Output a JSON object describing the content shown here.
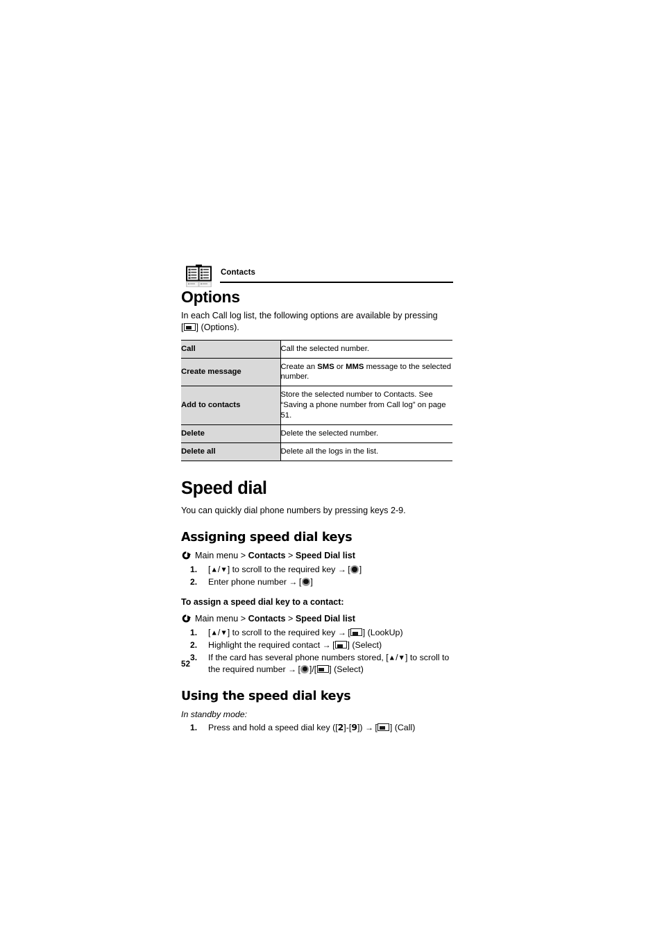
{
  "document": {
    "running_header": {
      "icon": "address-book-icon",
      "title": "Contacts"
    },
    "page_number": "52"
  },
  "sections": {
    "options": {
      "heading": "Options",
      "intro_before_key": "In each Call log list, the following options are available by pressing",
      "intro_key_icon": "softkey-icon",
      "intro_after_key": "] (Options).",
      "intro_bracket_open": "[",
      "table": {
        "rows": [
          {
            "name": "Call",
            "description": "Call the selected number."
          },
          {
            "name": "Create message",
            "desc_part1": "Create an ",
            "desc_bold1": "SMS",
            "desc_part2": " or ",
            "desc_bold2": "MMS",
            "desc_part3": " message to the selected number."
          },
          {
            "name": "Add to contacts",
            "description": "Store the selected number to Contacts. See “Saving a phone number from Call log” on page 51."
          },
          {
            "name": "Delete",
            "description": "Delete the selected number."
          },
          {
            "name": "Delete all",
            "description": "Delete all the logs in the list."
          }
        ]
      }
    },
    "speed_dial": {
      "heading": "Speed dial",
      "intro": "You can quickly dial phone numbers by pressing keys 2-9.",
      "assigning": {
        "heading": "Assigning speed dial keys",
        "path_prefix": "Main menu > ",
        "path_item1": "Contacts",
        "path_sep": " > ",
        "path_item2": "Speed Dial list",
        "steps": [
          {
            "open_bracket": "[",
            "up_arrow": "▲",
            "slash": "/",
            "down_arrow": "▼",
            "close_bracket": "]",
            "text": " to scroll to the required key ",
            "arrow": "→",
            "tail_open": " [",
            "tail_close": "]"
          },
          {
            "text": "Enter phone number ",
            "arrow": "→",
            "tail_open": " [",
            "tail_close": "]"
          }
        ]
      },
      "assign_to_contact": {
        "heading": "To assign a speed dial key to a contact:",
        "path_prefix": "Main menu > ",
        "path_item1": "Contacts",
        "path_sep": " > ",
        "path_item2": "Speed Dial list",
        "step1": {
          "open_bracket": "[",
          "up_arrow": "▲",
          "slash": "/",
          "down_arrow": "▼",
          "close_bracket": "]",
          "text": " to scroll to the required key ",
          "arrow": "→",
          "label": "] (LookUp)"
        },
        "step2": {
          "text": "Highlight the required contact ",
          "arrow": "→",
          "label": "] (Select)"
        },
        "step3": {
          "text_a": "If the card has several phone numbers stored, ",
          "open_bracket": "[",
          "up_arrow": "▲",
          "slash": "/",
          "down_arrow": "▼",
          "close_bracket": "]",
          "text_b": " to scroll to the required number ",
          "arrow": "→",
          "label": "] (Select)"
        }
      },
      "using": {
        "heading": "Using the speed dial keys",
        "mode_note": "In standby mode:",
        "step1": {
          "text_a": "Press and hold a speed dial key ([",
          "key_low": "2",
          "text_b": "]-[",
          "key_high": "9",
          "text_c": "]) ",
          "arrow": "→",
          "label": "] (Call)"
        }
      }
    }
  },
  "colors": {
    "table_header_cell_bg": "#d9d9d9",
    "rule": "#000000",
    "text": "#000000"
  }
}
